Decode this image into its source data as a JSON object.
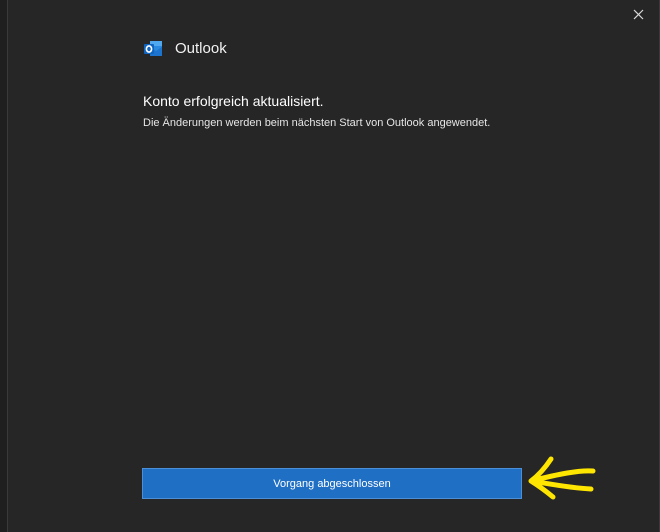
{
  "app": {
    "name": "Outlook",
    "icon": "outlook-icon"
  },
  "message": {
    "title": "Konto erfolgreich aktualisiert.",
    "body": "Die Änderungen werden beim nächsten Start von Outlook angewendet."
  },
  "actions": {
    "done_label": "Vorgang abgeschlossen"
  },
  "window": {
    "close_icon": "close-icon"
  },
  "colors": {
    "background": "#262626",
    "primary_button": "#1f6fc5",
    "outlook_brand": "#0f78d4",
    "annotation": "#ffe600"
  }
}
